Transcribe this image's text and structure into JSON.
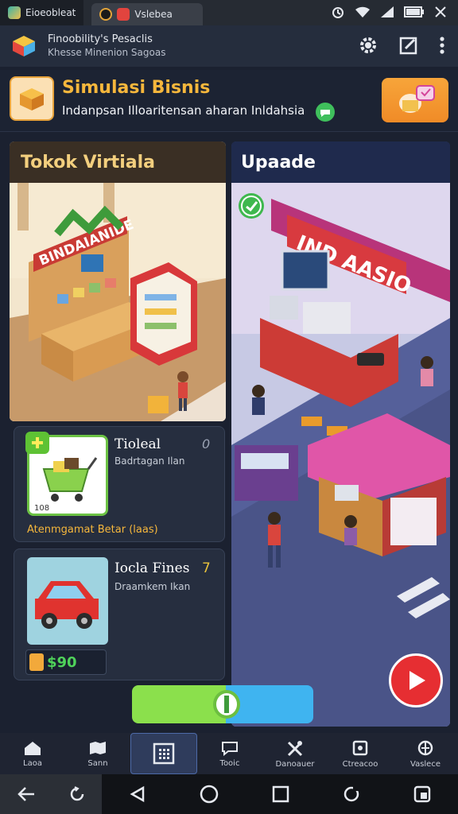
{
  "statusbar": {
    "tabs": [
      {
        "label": "Eioeobleat",
        "active": true
      },
      {
        "label": "Vslebea",
        "active": false
      }
    ]
  },
  "header": {
    "line1": "Finoobility's Pesaclis",
    "line2": "Khesse Minenion Sagoas"
  },
  "banner": {
    "title": "Simulasi Bisnis",
    "subtitle": "Indanpsan Illoaritensan aharan Inldahsia"
  },
  "left_panel": {
    "title": "Tokok Virtiala",
    "sign": "BINDAIANIDE"
  },
  "right_panel": {
    "title": "Upaade",
    "sign": "IND AASIO"
  },
  "card1": {
    "title": "Tioleal",
    "corner": "0",
    "desc": "Badrtagan Ilan",
    "footer": "Atenmgamat Betar (laas)",
    "img_text": "108"
  },
  "card2": {
    "title": "Iocla Fines",
    "corner": "7",
    "desc": "Draamkem Ikan",
    "price": "$90"
  },
  "bottom_nav": [
    {
      "label": "Laoa",
      "icon": "home-icon"
    },
    {
      "label": "Sann",
      "icon": "map-icon"
    },
    {
      "label": "",
      "icon": "grid-icon",
      "active": true
    },
    {
      "label": "Tooic",
      "icon": "chat-icon"
    },
    {
      "label": "Danoauer",
      "icon": "tools-icon"
    },
    {
      "label": "Ctreacoo",
      "icon": "shop-icon"
    },
    {
      "label": "Vaslece",
      "icon": "globe-icon"
    }
  ],
  "colors": {
    "accent_orange": "#f6b73c",
    "play_red": "#e62e32",
    "green_button": "#8be04c",
    "blue_button": "#3fb4f0"
  }
}
